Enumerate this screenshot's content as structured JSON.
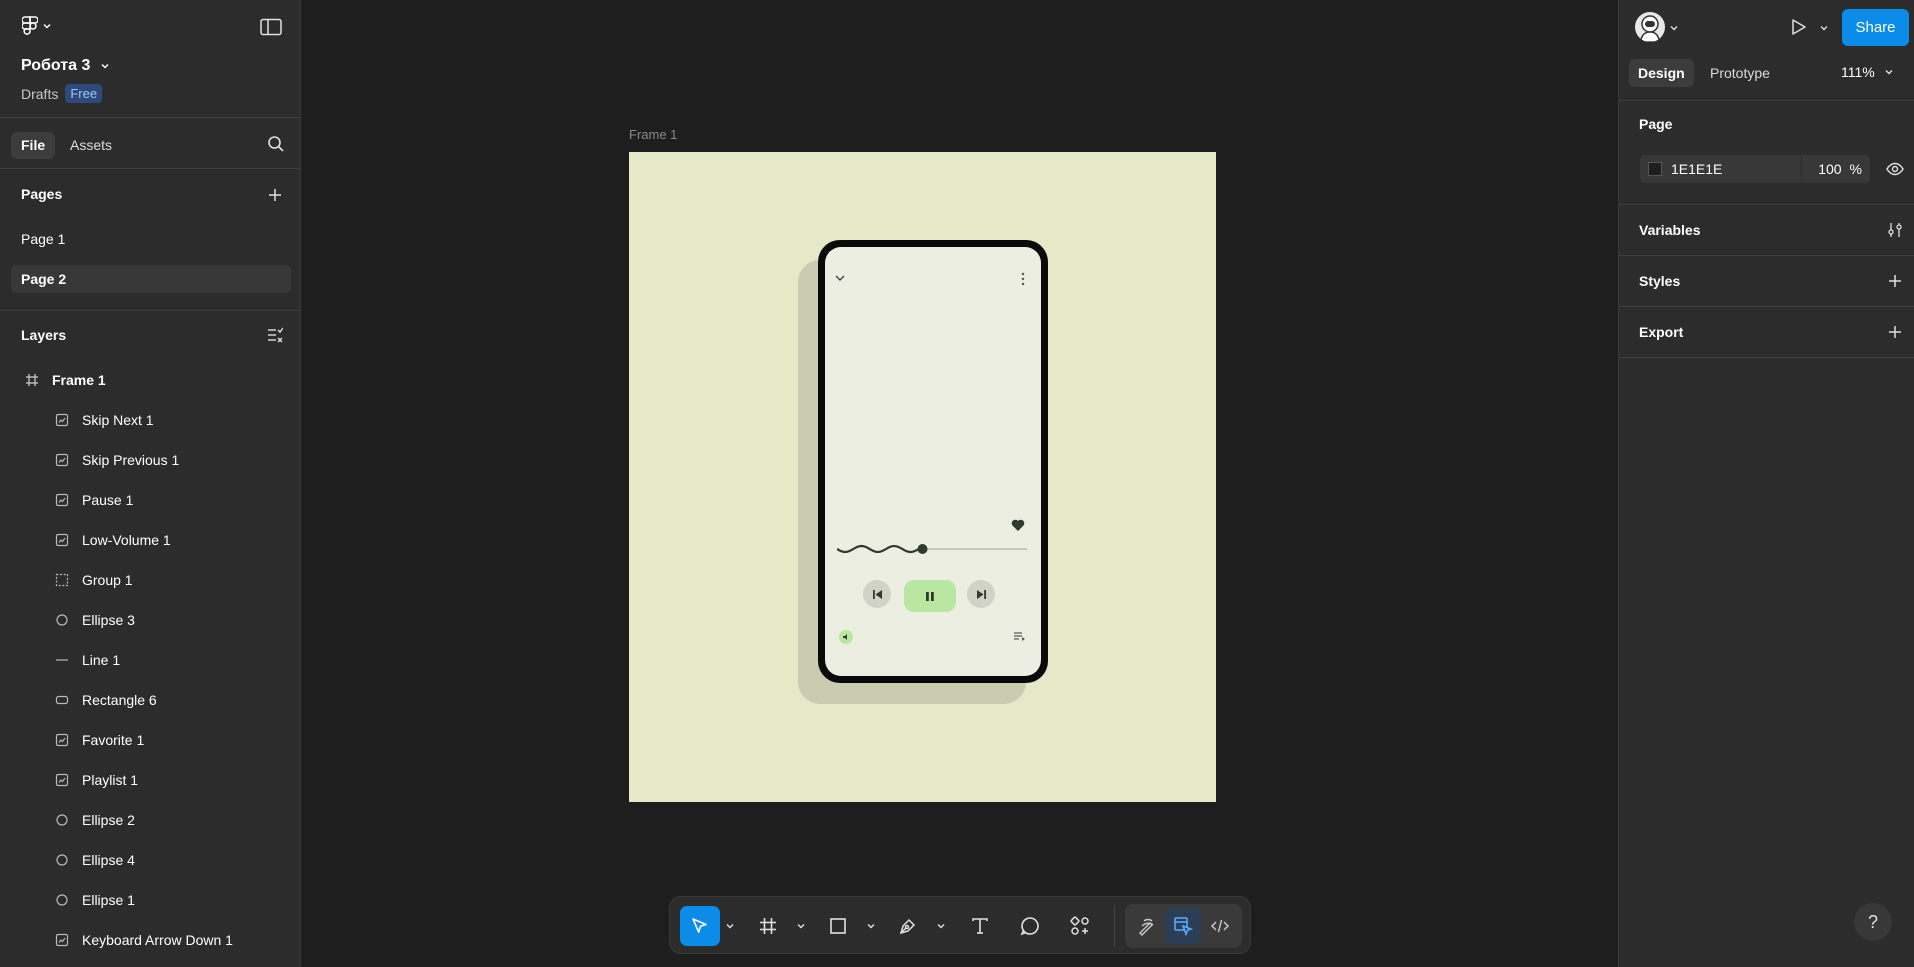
{
  "file": {
    "title": "Робота 3",
    "location": "Drafts",
    "plan": "Free"
  },
  "left_tabs": {
    "file": "File",
    "assets": "Assets"
  },
  "pages": {
    "heading": "Pages",
    "items": [
      "Page 1",
      "Page 2"
    ],
    "active": "Page 2"
  },
  "layers": {
    "heading": "Layers",
    "frame": "Frame 1",
    "items": [
      {
        "label": "Skip Next 1",
        "icon": "component-icon"
      },
      {
        "label": "Skip Previous 1",
        "icon": "component-icon"
      },
      {
        "label": "Pause 1",
        "icon": "component-icon"
      },
      {
        "label": "Low-Volume 1",
        "icon": "component-icon"
      },
      {
        "label": "Group 1",
        "icon": "group-icon"
      },
      {
        "label": "Ellipse 3",
        "icon": "ellipse-icon"
      },
      {
        "label": "Line 1",
        "icon": "line-icon"
      },
      {
        "label": "Rectangle 6",
        "icon": "rectangle-icon"
      },
      {
        "label": "Favorite 1",
        "icon": "component-icon"
      },
      {
        "label": "Playlist 1",
        "icon": "component-icon"
      },
      {
        "label": "Ellipse 2",
        "icon": "ellipse-icon"
      },
      {
        "label": "Ellipse 4",
        "icon": "ellipse-icon"
      },
      {
        "label": "Ellipse 1",
        "icon": "ellipse-icon"
      },
      {
        "label": "Keyboard Arrow Down 1",
        "icon": "component-icon"
      }
    ]
  },
  "canvas": {
    "frame_label": "Frame 1",
    "frame_color": "#e6e9c8",
    "progress": 0.45
  },
  "right_panel": {
    "share": "Share",
    "tabs": {
      "design": "Design",
      "prototype": "Prototype"
    },
    "zoom": "111%",
    "page_heading": "Page",
    "page_color": "1E1E1E",
    "page_opacity": "100",
    "percent": "%",
    "variables": "Variables",
    "styles": "Styles",
    "export": "Export",
    "help": "?"
  },
  "colors": {
    "accent": "#0c8ce9",
    "canvas_bg": "#1e1e1e",
    "panel_bg": "#2c2c2c"
  }
}
